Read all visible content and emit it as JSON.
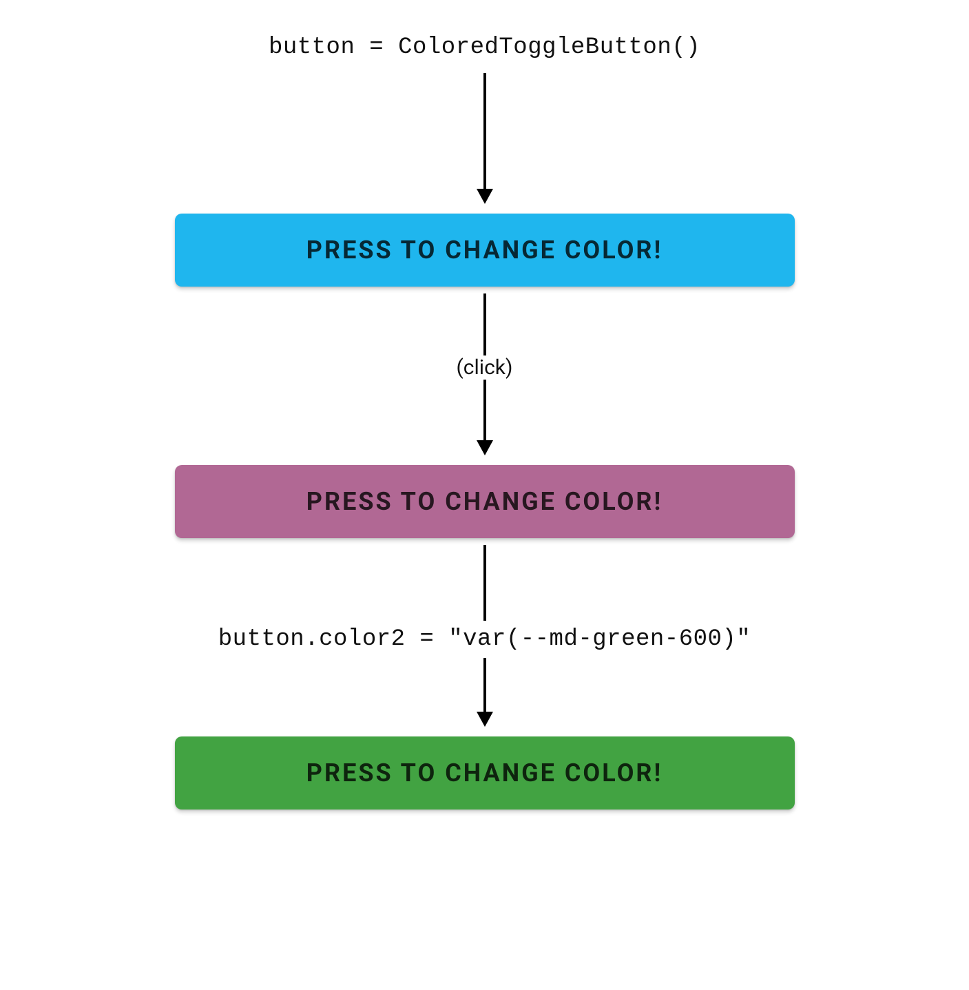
{
  "diagram": {
    "code_line_1": "button = ColoredToggleButton()",
    "click_annotation": "(click)",
    "code_line_2": "button.color2 = \"var(--md-green-600)\"",
    "button_label": "PRESS TO CHANGE COLOR!",
    "colors": {
      "state1": "#1fb6ee",
      "state2": "#b16894",
      "state3": "#42a342"
    }
  }
}
